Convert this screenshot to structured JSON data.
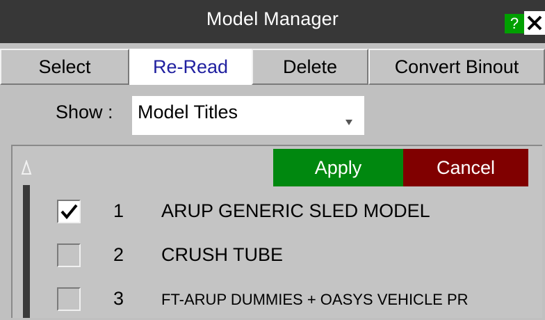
{
  "window": {
    "title": "Model Manager",
    "help_label": "?",
    "close_icon": "close-icon"
  },
  "toolbar": {
    "buttons": [
      {
        "label": "Select",
        "active": false
      },
      {
        "label": "Re-Read",
        "active": true
      },
      {
        "label": "Delete",
        "active": false
      },
      {
        "label": "Convert Binout",
        "active": false
      }
    ]
  },
  "show": {
    "label": "Show :",
    "selected": "Model Titles"
  },
  "actions": {
    "apply": "Apply",
    "cancel": "Cancel"
  },
  "models": [
    {
      "num": "1",
      "title": "ARUP GENERIC SLED MODEL",
      "checked": true
    },
    {
      "num": "2",
      "title": "CRUSH TUBE",
      "checked": false
    },
    {
      "num": "3",
      "title": "FT-ARUP DUMMIES + OASYS VEHICLE PR",
      "checked": false
    }
  ],
  "colors": {
    "titlebar": "#373737",
    "apply": "#00880f",
    "cancel": "#800000",
    "help": "#00a000",
    "background": "#c0c0c0"
  }
}
